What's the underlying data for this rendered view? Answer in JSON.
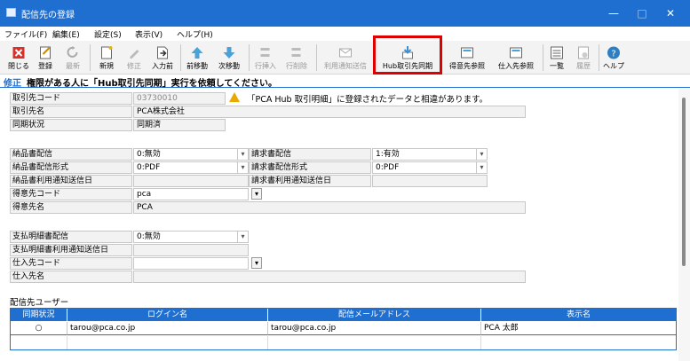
{
  "window": {
    "title": "配信先の登録",
    "min": "—",
    "max": "□",
    "close": "✕"
  },
  "menu": [
    "ファイル(F)",
    "編集(E)",
    "設定(S)",
    "表示(V)",
    "ヘルプ(H)"
  ],
  "toolbar": [
    "閉じる",
    "登録",
    "最新",
    "新規",
    "修正",
    "入力前",
    "前移動",
    "次移動",
    "行挿入",
    "行削除",
    "利用通知送信",
    "Hub取引先同期",
    "得意先参照",
    "仕入先参照",
    "一覧",
    "履歴",
    "ヘルプ"
  ],
  "message": {
    "mode": "修正",
    "text": "権限がある人に「Hub取引先同期」実行を依頼してください。"
  },
  "form": {
    "client_code_label": "取引先コード",
    "client_code": "03730010",
    "warning": "「PCA Hub 取引明細」に登録されたデータと相違があります。",
    "client_name_label": "取引先名",
    "client_name": "PCA株式会社",
    "sync_label": "同期状況",
    "sync": "同期済",
    "del_label": "納品書配信",
    "del": "0:無効",
    "bill_label": "請求書配信",
    "bill": "1:有効",
    "del_fmt_label": "納品書配信形式",
    "del_fmt": "0:PDF",
    "bill_fmt_label": "請求書配信形式",
    "bill_fmt": "0:PDF",
    "del_notice_label": "納品書利用通知送信日",
    "bill_notice_label": "請求書利用通知送信日",
    "cust_code_label": "得意先コード",
    "cust_code": "pca",
    "cust_name_label": "得意先名",
    "cust_name": "PCA",
    "pay_label": "支払明細書配信",
    "pay": "0:無効",
    "pay_notice_label": "支払明細書利用通知送信日",
    "sup_code_label": "仕入先コード",
    "sup_name_label": "仕入先名",
    "dd": "▾",
    "sb": "▾"
  },
  "users": {
    "title": "配信先ユーザー",
    "headers": [
      "同期状況",
      "ログイン名",
      "配信メールアドレス",
      "表示名"
    ],
    "rows": [
      {
        "status": "○",
        "login": "tarou@pca.co.jp",
        "email": "tarou@pca.co.jp",
        "name": "PCA 太郎"
      }
    ]
  }
}
